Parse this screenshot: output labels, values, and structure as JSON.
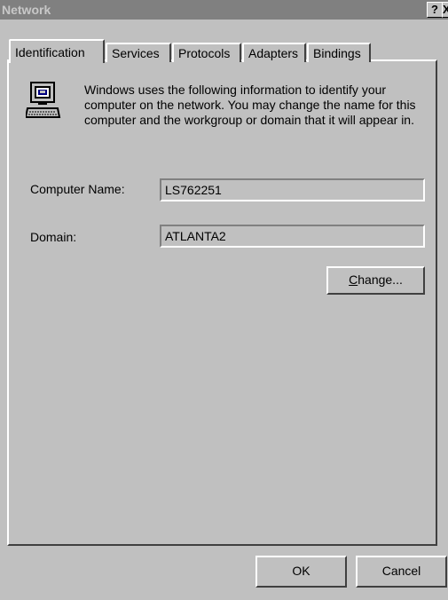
{
  "window": {
    "title": "Network",
    "help_label": "?",
    "close_label": "X"
  },
  "tabs": [
    {
      "label": "Identification",
      "active": true
    },
    {
      "label": "Services",
      "active": false
    },
    {
      "label": "Protocols",
      "active": false
    },
    {
      "label": "Adapters",
      "active": false
    },
    {
      "label": "Bindings",
      "active": false
    }
  ],
  "identification": {
    "icon": "computer-icon",
    "description": "Windows uses the following information to identify your computer on the network.  You may change the name for this computer and the workgroup or domain that it will appear in.",
    "computer_name_label": "Computer Name:",
    "computer_name_value": "LS762251",
    "domain_label": "Domain:",
    "domain_value": "ATLANTA2",
    "change_mnemonic": "C",
    "change_rest": "hange..."
  },
  "footer": {
    "ok_label": "OK",
    "cancel_label": "Cancel"
  }
}
